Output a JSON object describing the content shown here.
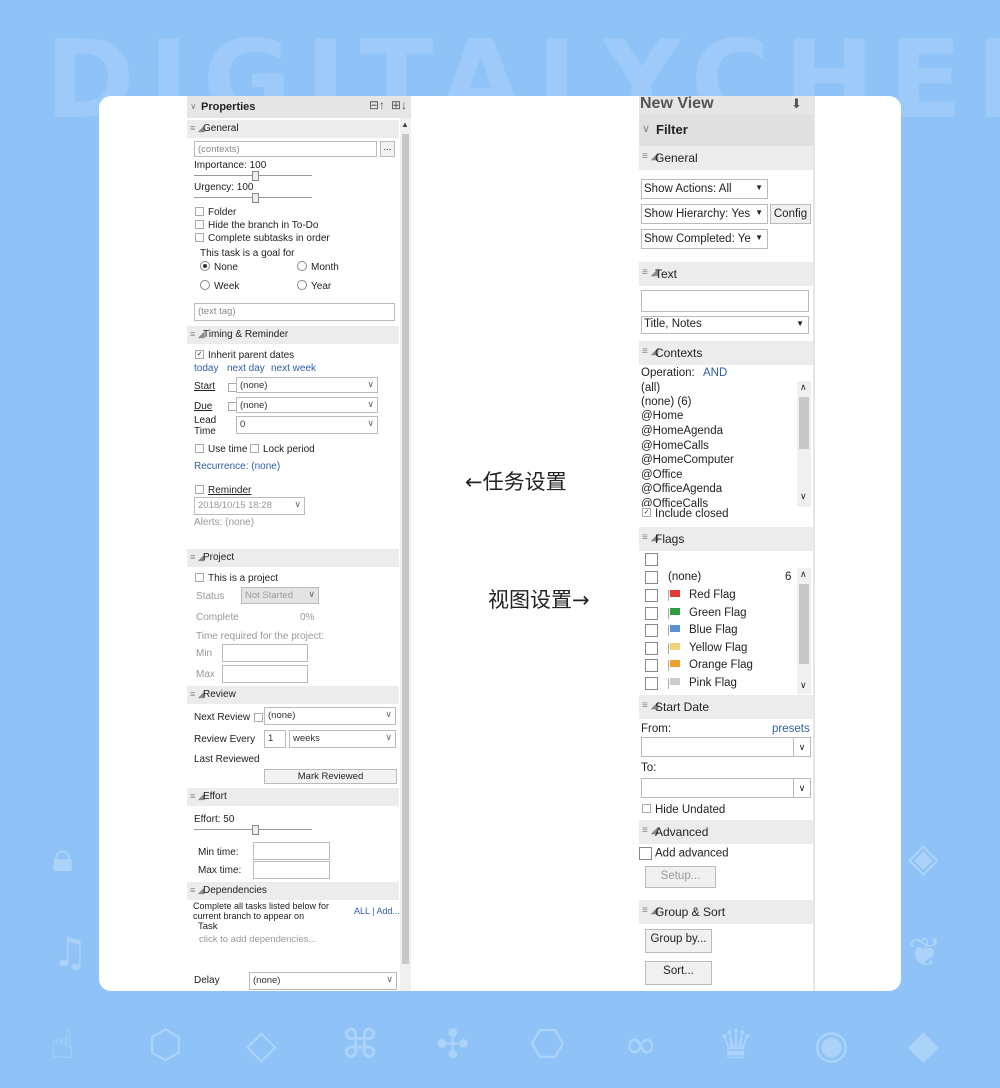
{
  "brand": {
    "watermark": "DIGITALYCHEE"
  },
  "labels": {
    "task_settings": "←任务设置",
    "view_settings": "视图设置→"
  },
  "properties": {
    "title": "Properties",
    "general": {
      "header": "General",
      "contexts_placeholder": "(contexts)",
      "ellipsis": "...",
      "importance_label": "Importance: 100",
      "importance_value": 100,
      "urgency_label": "Urgency: 100",
      "urgency_value": 100,
      "folder": "Folder",
      "hide_branch": "Hide the branch in To-Do",
      "complete_subtasks": "Complete subtasks in order",
      "goal_label": "This task is a goal for",
      "goal_options": [
        "None",
        "Month",
        "Week",
        "Year"
      ],
      "goal_selected": "None",
      "text_tag_placeholder": "(text tag)"
    },
    "timing": {
      "header": "Timing & Reminder",
      "inherit": "Inherit parent dates",
      "today": "today",
      "next_day": "next day",
      "next_week": "next week",
      "start_label": "Start",
      "start_value": "(none)",
      "due_label": "Due",
      "due_value": "(none)",
      "lead_label_1": "Lead",
      "lead_label_2": "Time",
      "lead_value": "0",
      "use_time": "Use time",
      "lock_period": "Lock period",
      "recurrence": "Recurrence: (none)",
      "reminder": "Reminder",
      "reminder_date": "2018/10/15 18:28",
      "alerts": "Alerts: (none)"
    },
    "project": {
      "header": "Project",
      "is_project": "This is a project",
      "status_label": "Status",
      "status_value": "Not Started",
      "complete_label": "Complete",
      "complete_value": "0%",
      "time_required": "Time required for the project:",
      "min_label": "Min",
      "max_label": "Max"
    },
    "review": {
      "header": "Review",
      "next_review": "Next Review",
      "next_review_value": "(none)",
      "review_every": "Review Every",
      "review_every_num": "1",
      "review_every_unit": "weeks",
      "last_reviewed": "Last Reviewed",
      "mark_reviewed": "Mark Reviewed"
    },
    "effort": {
      "header": "Effort",
      "effort_label": "Effort: 50",
      "effort_value": 50,
      "min_time": "Min time:",
      "max_time": "Max time:"
    },
    "dependencies": {
      "header": "Dependencies",
      "desc_1": "Complete all tasks listed below for",
      "desc_2": "current branch to appear on",
      "links": "ALL | Add...",
      "task_col": "Task",
      "click_add": "click to add dependencies...",
      "delay_label": "Delay",
      "delay_value": "(none)"
    }
  },
  "view": {
    "title": "New View",
    "filter": "Filter",
    "general": {
      "header": "General",
      "show_actions": "Show Actions: All",
      "show_hierarchy": "Show Hierarchy: Yes",
      "config": "Config",
      "show_completed": "Show  Completed: Ye"
    },
    "text": {
      "header": "Text",
      "fields": "Title, Notes"
    },
    "contexts": {
      "header": "Contexts",
      "operation_label": "Operation:",
      "operation_value": "AND",
      "items": [
        "(all)",
        "(none) (6)",
        "@Home",
        "@HomeAgenda",
        "@HomeCalls",
        "@HomeComputer",
        "@Office",
        "@OfficeAgenda",
        "@OfficeCalls"
      ],
      "include_closed": "Include closed"
    },
    "flags": {
      "header": "Flags",
      "none_label": "(none)",
      "none_count": "6",
      "items": [
        {
          "name": "Red Flag",
          "color": "#e53935"
        },
        {
          "name": "Green Flag",
          "color": "#2e9e3e"
        },
        {
          "name": "Blue Flag",
          "color": "#5b8fd6"
        },
        {
          "name": "Yellow Flag",
          "color": "#f4d27a"
        },
        {
          "name": "Orange Flag",
          "color": "#f0a030"
        },
        {
          "name": "Pink Flag",
          "color": "#cccccc"
        }
      ]
    },
    "start_date": {
      "header": "Start Date",
      "from": "From:",
      "presets": "presets",
      "to": "To:",
      "hide_undated": "Hide Undated"
    },
    "advanced": {
      "header": "Advanced",
      "add_advanced": "Add advanced",
      "setup": "Setup..."
    },
    "group_sort": {
      "header": "Group & Sort",
      "group_by": "Group by...",
      "sort": "Sort..."
    }
  }
}
